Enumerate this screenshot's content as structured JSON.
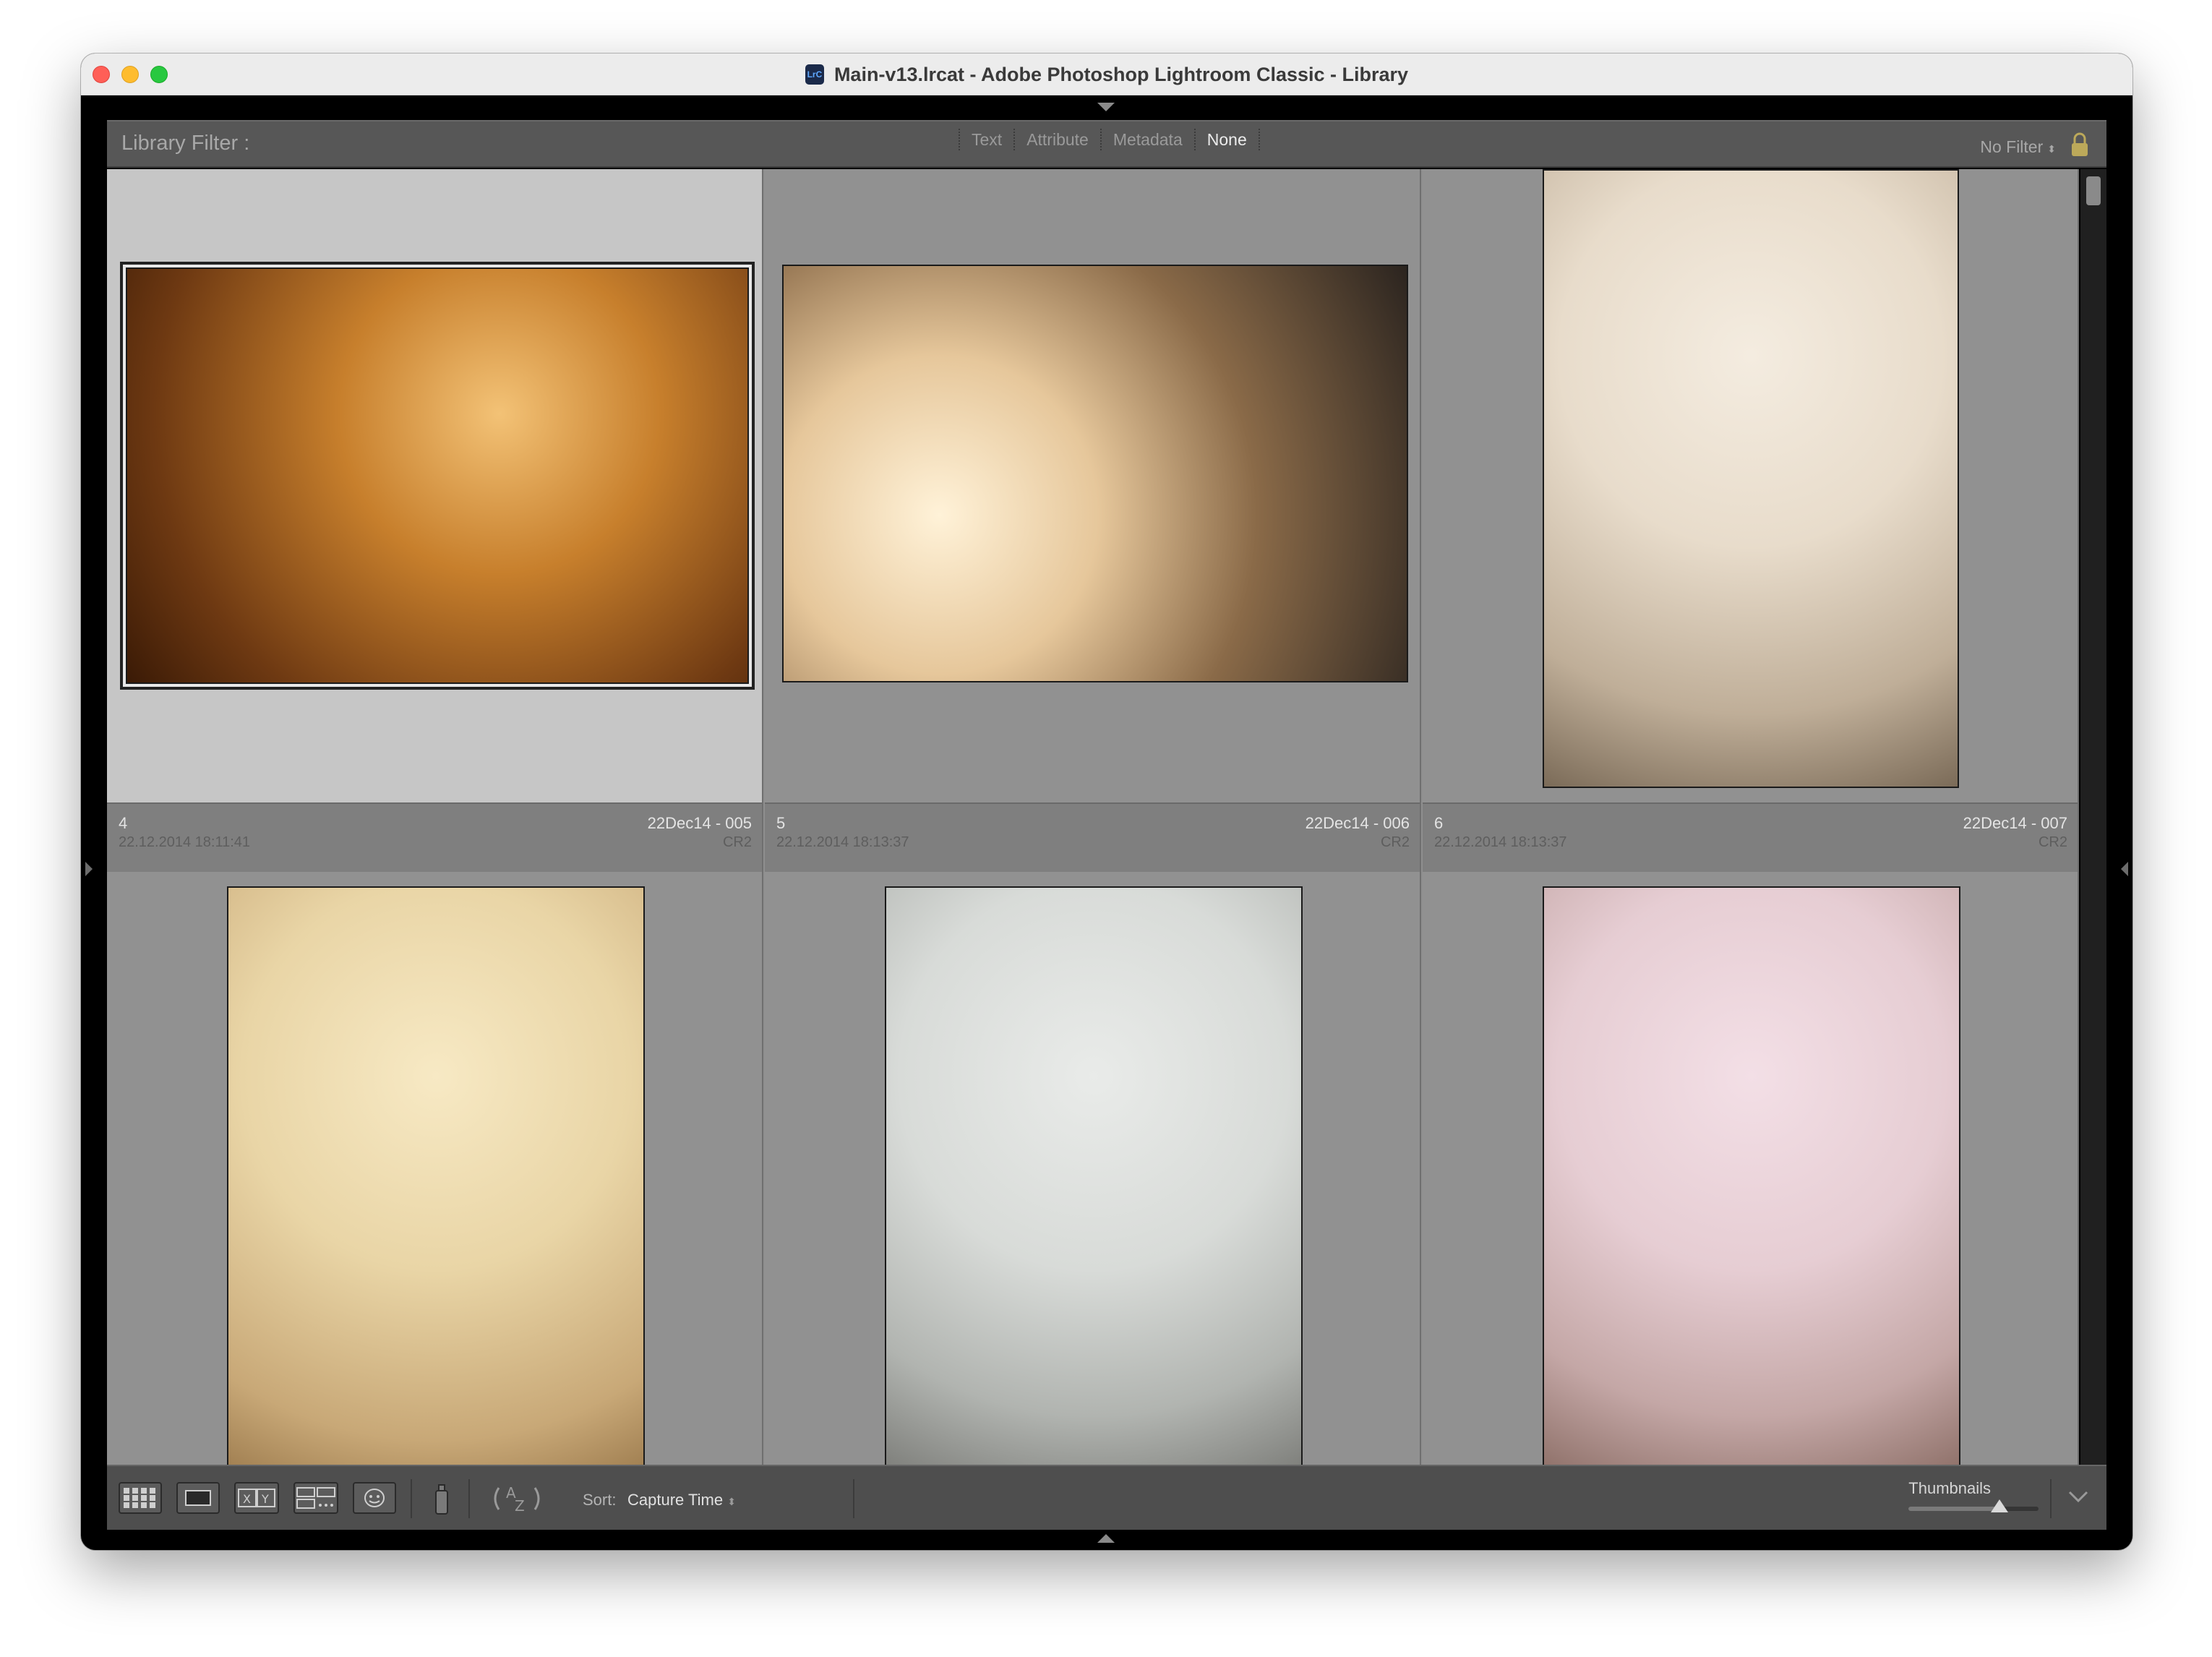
{
  "window": {
    "title": "Main-v13.lrcat - Adobe Photoshop Lightroom Classic - Library",
    "app_icon_text": "LrC"
  },
  "filter_bar": {
    "label": "Library Filter :",
    "tabs": [
      "Text",
      "Attribute",
      "Metadata",
      "None"
    ],
    "active_tab": "None",
    "preset": "No Filter"
  },
  "grid": {
    "cells": [
      {
        "index": "4",
        "name": "22Dec14 - 005",
        "date": "22.12.2014 18:11:41",
        "format": "CR2"
      },
      {
        "index": "5",
        "name": "22Dec14 - 006",
        "date": "22.12.2014 18:13:37",
        "format": "CR2"
      },
      {
        "index": "6",
        "name": "22Dec14 - 007",
        "date": "22.12.2014 18:13:37",
        "format": "CR2"
      }
    ]
  },
  "toolbar": {
    "sort_label": "Sort:",
    "sort_value": "Capture Time",
    "thumbnails_label": "Thumbnails",
    "thumbnail_size": 0.7
  },
  "colors": {
    "selected_cell": "#c6c6c6",
    "cell": "#919191",
    "panel": "#575757"
  }
}
